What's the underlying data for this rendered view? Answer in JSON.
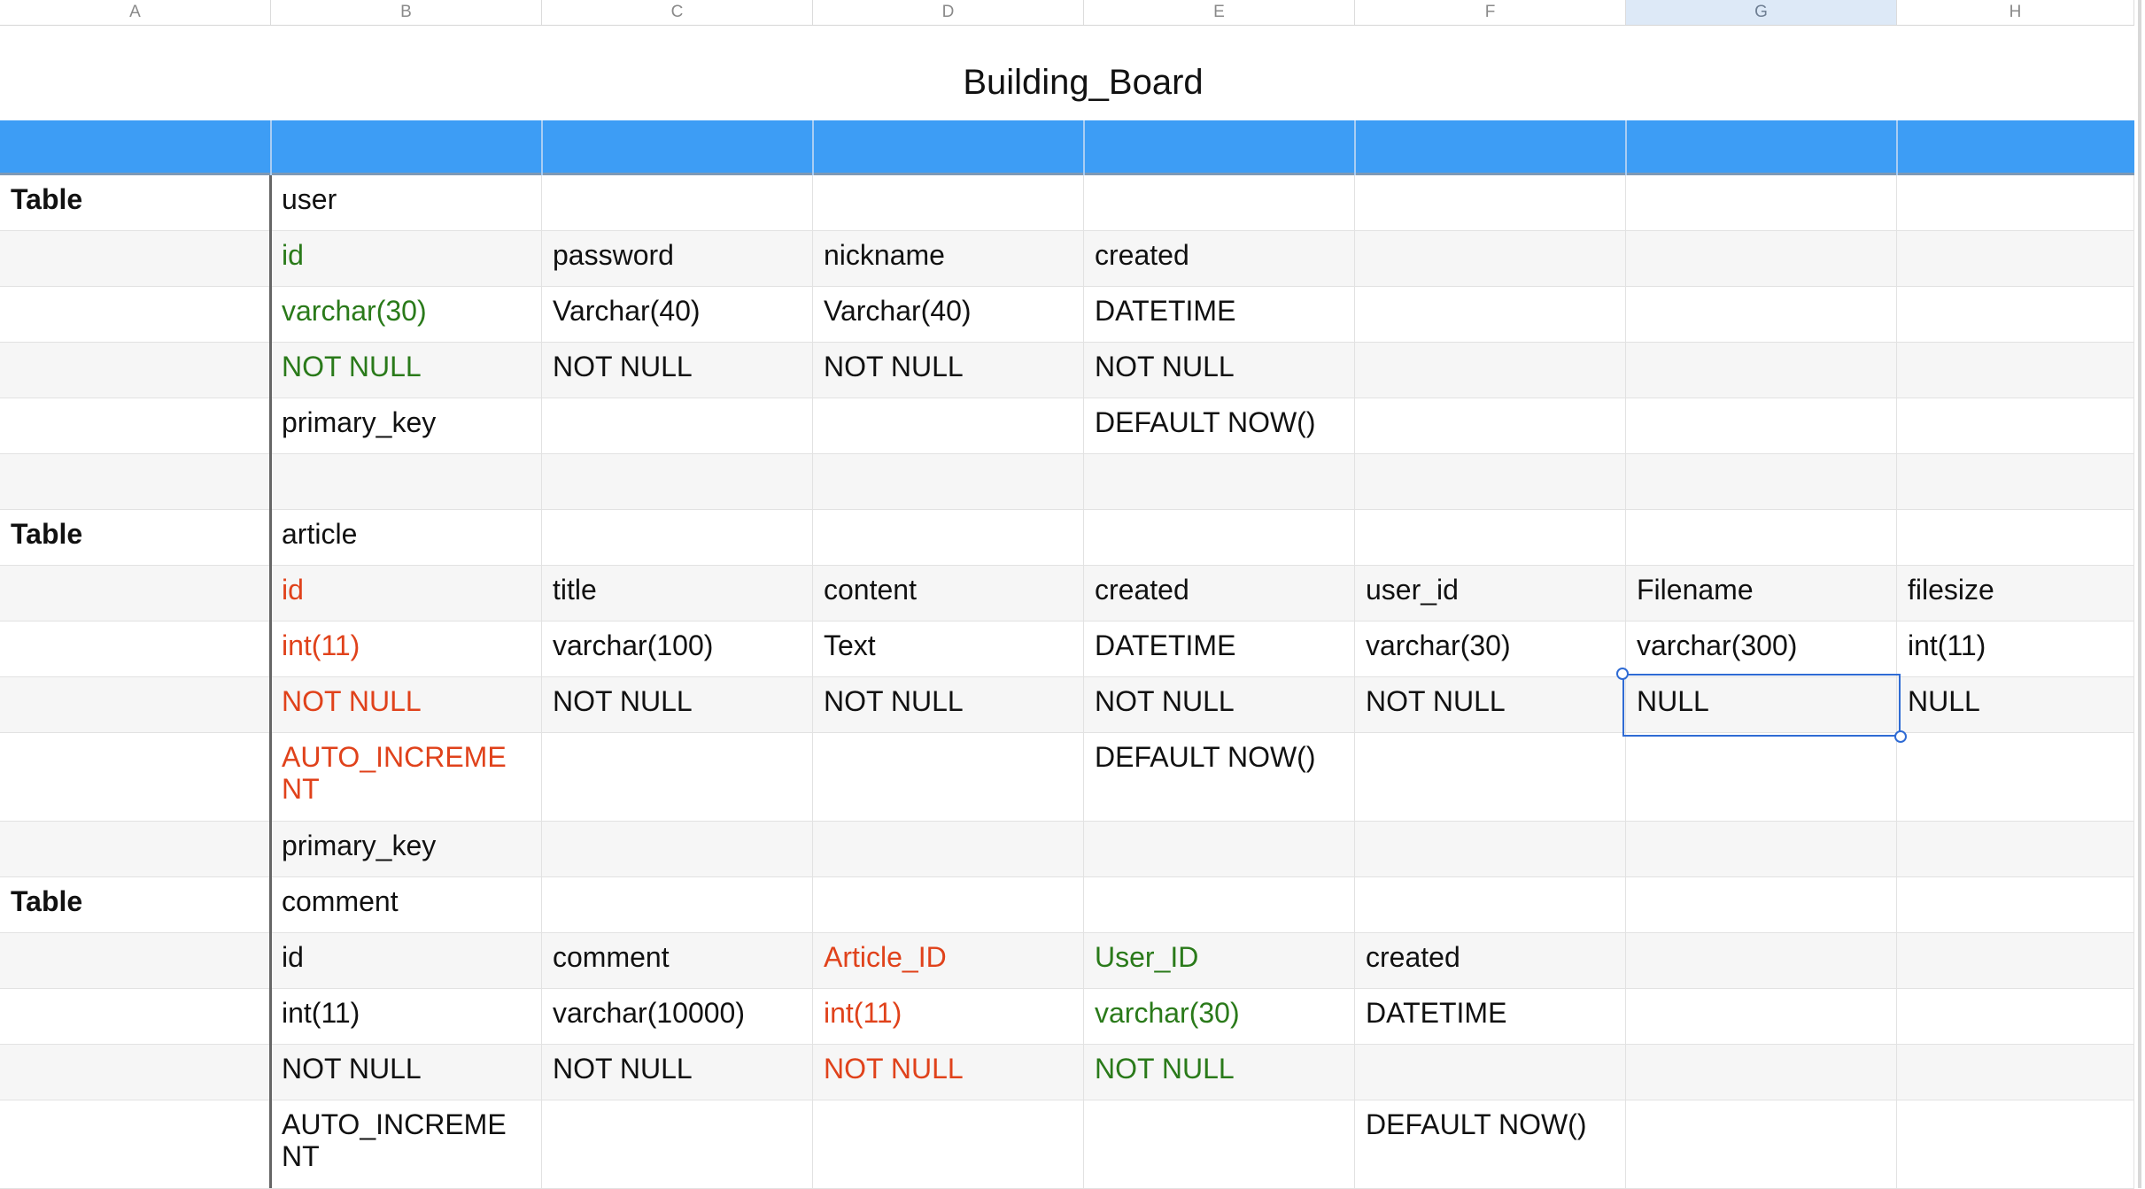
{
  "columns": [
    "A",
    "B",
    "C",
    "D",
    "E",
    "F",
    "G",
    "H"
  ],
  "selected_column": "G",
  "sheet_title": "Building_Board",
  "rows": [
    {
      "cells": [
        "Table",
        "user",
        "",
        "",
        "",
        "",
        "",
        ""
      ],
      "styles": [
        "bold",
        "",
        "",
        "",
        "",
        "",
        "",
        ""
      ],
      "alt": false
    },
    {
      "cells": [
        "",
        "id",
        "password",
        "nickname",
        "created",
        "",
        "",
        ""
      ],
      "styles": [
        "",
        "green",
        "",
        "",
        "",
        "",
        "",
        ""
      ],
      "alt": true
    },
    {
      "cells": [
        "",
        "varchar(30)",
        "Varchar(40)",
        "Varchar(40)",
        "DATETIME",
        "",
        "",
        ""
      ],
      "styles": [
        "",
        "green",
        "",
        "",
        "",
        "",
        "",
        ""
      ],
      "alt": false
    },
    {
      "cells": [
        "",
        "NOT NULL",
        "NOT NULL",
        "NOT NULL",
        "NOT NULL",
        "",
        "",
        ""
      ],
      "styles": [
        "",
        "green",
        "",
        "",
        "",
        "",
        "",
        ""
      ],
      "alt": true
    },
    {
      "cells": [
        "",
        "primary_key",
        "",
        "",
        "DEFAULT NOW()",
        "",
        "",
        ""
      ],
      "styles": [
        "",
        "",
        "",
        "",
        "",
        "",
        "",
        ""
      ],
      "alt": false
    },
    {
      "cells": [
        "",
        "",
        "",
        "",
        "",
        "",
        "",
        ""
      ],
      "styles": [
        "",
        "",
        "",
        "",
        "",
        "",
        "",
        ""
      ],
      "alt": true
    },
    {
      "cells": [
        "Table",
        "article",
        "",
        "",
        "",
        "",
        "",
        ""
      ],
      "styles": [
        "bold",
        "",
        "",
        "",
        "",
        "",
        "",
        ""
      ],
      "alt": false
    },
    {
      "cells": [
        "",
        "id",
        "title",
        "content",
        "created",
        "user_id",
        "Filename",
        "filesize"
      ],
      "styles": [
        "",
        "red",
        "",
        "",
        "",
        "",
        "",
        ""
      ],
      "alt": true
    },
    {
      "cells": [
        "",
        "int(11)",
        "varchar(100)",
        "Text",
        "DATETIME",
        "varchar(30)",
        "varchar(300)",
        "int(11)"
      ],
      "styles": [
        "",
        "red",
        "",
        "",
        "",
        "",
        "",
        ""
      ],
      "alt": false
    },
    {
      "cells": [
        "",
        "NOT NULL",
        "NOT NULL",
        "NOT NULL",
        "NOT NULL",
        "NOT NULL",
        "NULL",
        "NULL"
      ],
      "styles": [
        "",
        "red",
        "",
        "",
        "",
        "",
        "",
        ""
      ],
      "alt": true
    },
    {
      "cells": [
        "",
        "AUTO_INCREMENT",
        "",
        "",
        "DEFAULT NOW()",
        "",
        "",
        ""
      ],
      "styles": [
        "",
        "red",
        "",
        "",
        "",
        "",
        "",
        ""
      ],
      "alt": false
    },
    {
      "cells": [
        "",
        "primary_key",
        "",
        "",
        "",
        "",
        "",
        ""
      ],
      "styles": [
        "",
        "",
        "",
        "",
        "",
        "",
        "",
        ""
      ],
      "alt": true
    },
    {
      "cells": [
        "Table",
        "comment",
        "",
        "",
        "",
        "",
        "",
        ""
      ],
      "styles": [
        "bold",
        "",
        "",
        "",
        "",
        "",
        "",
        ""
      ],
      "alt": false
    },
    {
      "cells": [
        "",
        "id",
        "comment",
        "Article_ID",
        "User_ID",
        "created",
        "",
        ""
      ],
      "styles": [
        "",
        "",
        "",
        "red",
        "green",
        "",
        "",
        ""
      ],
      "alt": true
    },
    {
      "cells": [
        "",
        "int(11)",
        "varchar(10000)",
        "int(11)",
        "varchar(30)",
        "DATETIME",
        "",
        ""
      ],
      "styles": [
        "",
        "",
        "",
        "red",
        "green",
        "",
        "",
        ""
      ],
      "alt": false
    },
    {
      "cells": [
        "",
        "NOT NULL",
        "NOT NULL",
        "NOT NULL",
        "NOT NULL",
        "",
        "",
        ""
      ],
      "styles": [
        "",
        "",
        "",
        "red",
        "green",
        "",
        "",
        ""
      ],
      "alt": true
    },
    {
      "cells": [
        "",
        "AUTO_INCREMENT",
        "",
        "",
        "",
        "DEFAULT NOW()",
        "",
        ""
      ],
      "styles": [
        "",
        "",
        "",
        "",
        "",
        "",
        "",
        ""
      ],
      "alt": false
    }
  ],
  "selected_cell": "G10",
  "colors": {
    "header_band": "#3d9df5",
    "pk_green": "#2a7a1a",
    "fk_red": "#e0421b",
    "selection": "#2f6bd4"
  }
}
